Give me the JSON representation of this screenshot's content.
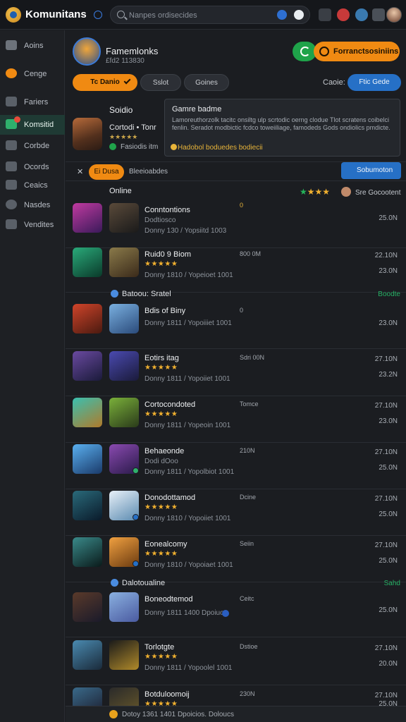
{
  "topbar": {
    "brand": "Komunitans",
    "search_placeholder": "Nanpes ordisecides",
    "icons": [
      "settings-gear-icon",
      "alert-icon",
      "globe-icon",
      "sparkle-icon"
    ]
  },
  "sidebar": {
    "items": [
      {
        "label": "Aoins",
        "icon": "bird-icon",
        "color": "#8a9099"
      },
      {
        "label": "Cenge",
        "icon": "orange-disc-icon",
        "color": "#f08a12"
      },
      {
        "label": "Fariers",
        "icon": "card-icon",
        "color": "#7d838b"
      },
      {
        "label": "Komsitid",
        "icon": "game-icon",
        "color": "#2fb06c"
      },
      {
        "label": "Corbde",
        "icon": "controller-icon",
        "color": "#7d838b"
      },
      {
        "label": "Ocords",
        "icon": "chart-icon",
        "color": "#7d838b"
      },
      {
        "label": "Ceaics",
        "icon": "wave-icon",
        "color": "#7d838b"
      },
      {
        "label": "Nasdes",
        "icon": "compass-icon",
        "color": "#7d838b"
      },
      {
        "label": "Vendites",
        "icon": "puzzle-icon",
        "color": "#7d838b"
      }
    ]
  },
  "profile": {
    "name": "Famemlonks",
    "sub": "£fd2 113830",
    "action_label": "Forranctsosiniins"
  },
  "filters": {
    "primary": "Tc Danio",
    "secondary": [
      "Sslot",
      "Goines"
    ],
    "sort_label": "Caoie:",
    "sort_value": "Ftic Gede"
  },
  "featured": {
    "section": "Soidio",
    "name": "Cortodi • Tonr",
    "rating": "★★★★★",
    "meta": "Fasiodis itm"
  },
  "tooltip": {
    "title": "Gamre badme",
    "body": "Lamoreuthorzolk tacitc onsiltg ulp scrtodic oerng clodue Tlot scratens coibelci fenlin. Seradot modbictic fcdco toweiiliage, famodeds Gods ondiolics pmdicte.",
    "link": "Hadobol boduedes bodiecii"
  },
  "filter_row": {
    "pill": "Ei Dusa",
    "label": "Bleeioabdes",
    "button": "Sobumoton"
  },
  "online_section": {
    "label": "Online",
    "mid": "0",
    "right": "Sre Gocootent"
  },
  "groups": [
    {
      "label": "Batoou: Sratel",
      "right": "Boodte"
    },
    {
      "label": "Dalotoualine",
      "right": "Sahd"
    }
  ],
  "rows": [
    {
      "title": "Conntontions",
      "sub": "Dodtiosco",
      "meta": "Donny 130 / Yopsiitd  1003",
      "mid": "",
      "v1": "",
      "v2": "25.0N",
      "t1": "#6a2d8a",
      "t2": "#3a2a22"
    },
    {
      "title": "Ruid0 9 Biom",
      "stars": "★★★★★",
      "meta": "Donny 1810 / Yopeioet  1001",
      "mid": "800 0M",
      "v1": "22.10N",
      "v2": "23.0N",
      "t1": "#1e6b4a",
      "t2": "#5a4a2a"
    },
    {
      "title": "Bdis of Biny",
      "sub": "",
      "meta": "Donny 1811 / Yopoiiiet  1001",
      "mid": "0",
      "v1": "",
      "v2": "23.0N",
      "t1": "#9a2a1c",
      "t2": "#3a6a9a"
    },
    {
      "title": "Eotirs itag",
      "stars": "★★★★★",
      "meta": "Donny 1811 / Yopoiiet  1001",
      "mid": "Sdri 00N",
      "v1": "27.10N",
      "v2": "23.2N",
      "t1": "#3a2a6a",
      "t2": "#2a3a7a"
    },
    {
      "title": "Cortocondoted",
      "stars": "★★★★★",
      "meta": "Donny 1811 / Yopeoin  1001",
      "mid": "Tomce",
      "v1": "27.10N",
      "v2": "23.0N",
      "t1": "#2a8a7a",
      "t2": "#4a7a2a"
    },
    {
      "title": "Behaeonde",
      "sub": "Dodi dOoo",
      "meta": "Donny 1811 / Yopolbiot  1001",
      "mid": "210N",
      "v1": "27.10N",
      "v2": "25.0N",
      "t1": "#3a7aaa",
      "t2": "#5a3a8a"
    },
    {
      "title": "Donodottamod",
      "stars": "★★★★★",
      "meta": "Donny 1810 / Yopoiiet  1001",
      "mid": "Dcine",
      "v1": "27.10N",
      "v2": "25.0N",
      "t1": "#1a3a4a",
      "t2": "#4a6a8a"
    },
    {
      "title": "Eonealcomy",
      "stars": "★★★★★",
      "meta": "Donny 1810 / Yopoiaet  1001",
      "mid": "Seiin",
      "v1": "27.10N",
      "v2": "25.0N",
      "t1": "#2a5a5a",
      "t2": "#c07a2a"
    },
    {
      "title": "Boneodtemod",
      "sub": "",
      "meta": "Donny 1811 1400 Dpoiuos.",
      "mid": "Ceitc",
      "v1": "",
      "v2": "25.0N",
      "t1": "#2a2a4a",
      "t2": "#4a6aaa"
    },
    {
      "title": "Torlotgte",
      "stars": "★★★★★",
      "meta": "Donny 1811 / Yopoolel  1001",
      "mid": "Dstioe",
      "v1": "27.10N",
      "v2": "20.0N",
      "t1": "#2a6a9a",
      "t2": "#5a3a1a"
    },
    {
      "title": "Botduloomoij",
      "stars": "★★★★★",
      "meta": "",
      "mid": "230N",
      "v1": "27.10N",
      "v2": "25.0N",
      "t1": "#2a4a6a",
      "t2": "#3a2a1a"
    }
  ],
  "bottom_strip": {
    "text": "Dotoy 1361 1401 Dpoicios. Doloucs"
  }
}
